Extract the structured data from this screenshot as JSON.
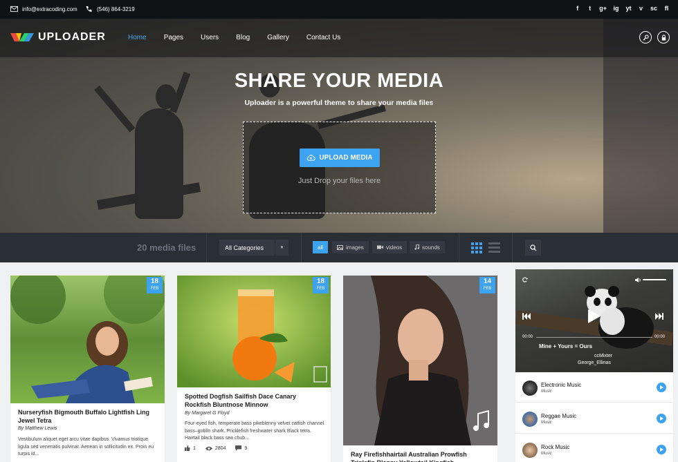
{
  "topbar": {
    "email": "info@extracoding.com",
    "phone": "(546) 864-3219",
    "social": [
      "f",
      "t",
      "g+",
      "ig",
      "yt",
      "v",
      "sc",
      "fl"
    ]
  },
  "nav": {
    "brand": "UPLOADER",
    "items": [
      {
        "label": "Home",
        "active": true
      },
      {
        "label": "Pages"
      },
      {
        "label": "Users"
      },
      {
        "label": "Blog"
      },
      {
        "label": "Gallery"
      },
      {
        "label": "Contact Us"
      }
    ]
  },
  "hero": {
    "title": "SHARE YOUR MEDIA",
    "subtitle": "Uploader is a powerful theme to share your media files",
    "upload_label": "UPLOAD MEDIA",
    "drop_text": "Just Drop your files here"
  },
  "filters": {
    "count": "20 media files",
    "category": "All Categories",
    "tabs": [
      "all",
      "images",
      "videos",
      "sounds"
    ]
  },
  "cards": [
    {
      "day": "18",
      "month": "FEB",
      "title": "Nurseryfish Bigmouth Buffalo Lightfish Ling Jewel Tetra",
      "author": "By Matthew Lewis",
      "excerpt": "Vestibulum aliquet eget arcu vitae dapibus. Vivamus tristique ligula sed venenatis pulvinar. Aenean in sollicitudin ex. Proin eu turpis id..."
    },
    {
      "day": "18",
      "month": "FEB",
      "title": "Spotted Dogfish Sailfish Dace Canary Rockfish Bluntnose Minnow",
      "author": "By Margaret G Floyd",
      "excerpt": "Four-eyed fish, temperate bass pikeblenny velvet catfish channel bass–goblin shark. Pricklefish freshwater shark Black tetra. Hairtail black bass sea chub…",
      "likes": "1",
      "views": "2804",
      "comments": "9"
    },
    {
      "day": "14",
      "month": "FEB",
      "title": "Ray Firefishhairtail Australian Prowfish Triplefin Blenny Yellowtail Kingfish"
    }
  ],
  "player": {
    "time_start": "00:00",
    "time_end": "00:00",
    "song": "Mine + Yours = Ours",
    "artist_line1": "ccMixter",
    "artist_line2": "George_Ellinas",
    "tracks": [
      {
        "name": "Electronic Music",
        "genre": "Music"
      },
      {
        "name": "Reggae Music",
        "genre": "Music"
      },
      {
        "name": "Rock Music",
        "genre": "Music"
      }
    ]
  },
  "colors": {
    "accent": "#3da3f0",
    "dark": "#2a2e35"
  }
}
